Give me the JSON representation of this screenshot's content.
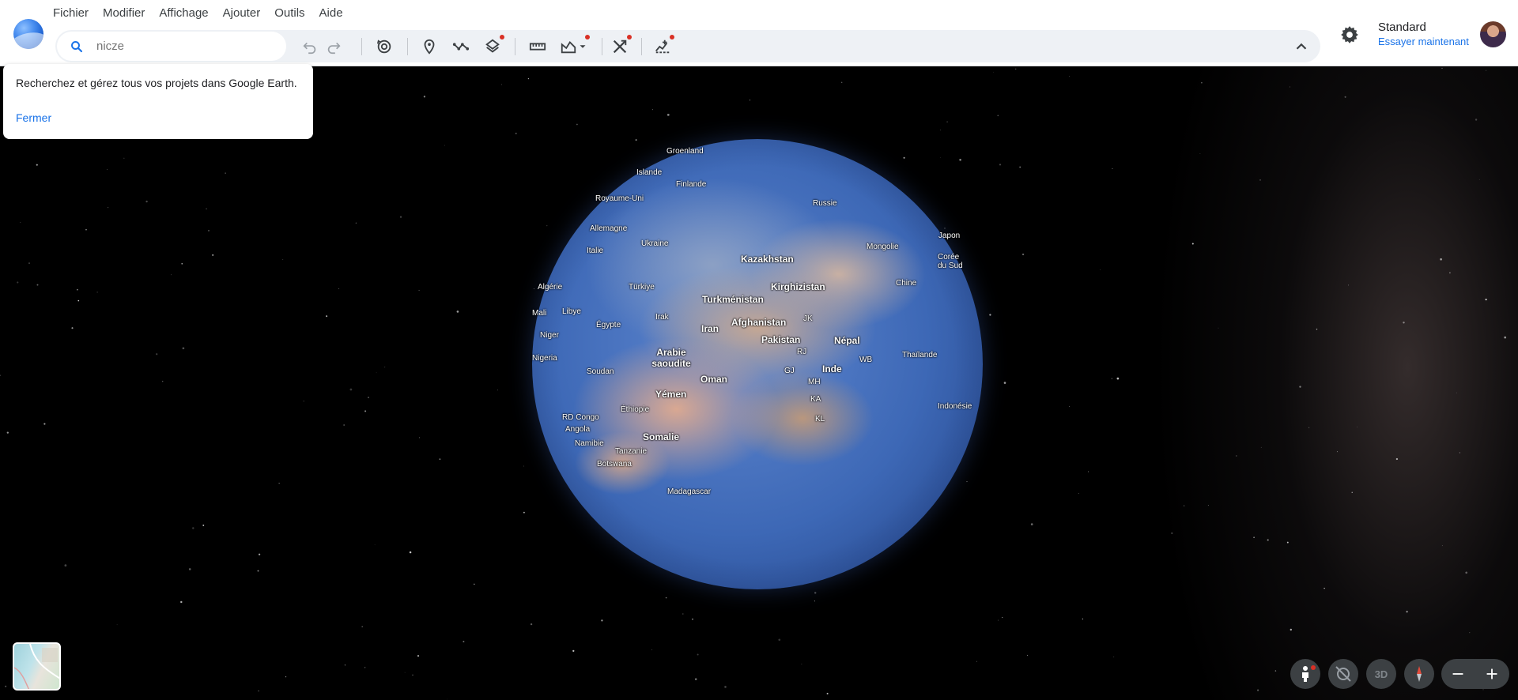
{
  "menubar": {
    "items": [
      "Fichier",
      "Modifier",
      "Affichage",
      "Ajouter",
      "Outils",
      "Aide"
    ]
  },
  "search": {
    "placeholder": "nicze"
  },
  "toolbar": {
    "undo_icon": "undo-icon",
    "redo_icon": "redo-icon",
    "history_icon": "history-icon",
    "placemark_icon": "placemark-icon",
    "path_icon": "path-icon",
    "layers_icon": "layers-icon",
    "ruler_icon": "ruler-icon",
    "image_overlay_icon": "image-overlay-icon",
    "tools_icon": "tools-icon",
    "data_import_icon": "data-import-icon",
    "collapse_icon": "chevron-up-icon"
  },
  "account": {
    "plan": "Standard",
    "upgrade_link": "Essayer maintenant"
  },
  "popup": {
    "message": "Recherchez et gérez tous vos projets dans Google Earth.",
    "close_label": "Fermer"
  },
  "globe": {
    "labels": [
      {
        "text": "Groenland",
        "big": false
      },
      {
        "text": "Islande",
        "big": false
      },
      {
        "text": "Finlande",
        "big": false
      },
      {
        "text": "Royaume-Uni",
        "big": false
      },
      {
        "text": "Russie",
        "big": false
      },
      {
        "text": "Allemagne",
        "big": false
      },
      {
        "text": "Ukraine",
        "big": false
      },
      {
        "text": "Italie",
        "big": false
      },
      {
        "text": "Kazakhstan",
        "big": true
      },
      {
        "text": "Mongolie",
        "big": false
      },
      {
        "text": "Japon",
        "big": false
      },
      {
        "text": "Corée du Sud",
        "big": false
      },
      {
        "text": "Algérie",
        "big": false
      },
      {
        "text": "Türkiye",
        "big": false
      },
      {
        "text": "Kirghizistan",
        "big": true
      },
      {
        "text": "Chine",
        "big": false
      },
      {
        "text": "Turkménistan",
        "big": true
      },
      {
        "text": "Mali",
        "big": false
      },
      {
        "text": "Libye",
        "big": false
      },
      {
        "text": "Irak",
        "big": false
      },
      {
        "text": "Afghanistan",
        "big": true
      },
      {
        "text": "JK",
        "big": false
      },
      {
        "text": "Égypte",
        "big": false
      },
      {
        "text": "Iran",
        "big": true
      },
      {
        "text": "Niger",
        "big": false
      },
      {
        "text": "Pakistan",
        "big": true
      },
      {
        "text": "Népal",
        "big": true
      },
      {
        "text": "RJ",
        "big": false
      },
      {
        "text": "Nigeria",
        "big": false
      },
      {
        "text": "Arabie saoudite",
        "big": true
      },
      {
        "text": "WB",
        "big": false
      },
      {
        "text": "Thaïlande",
        "big": false
      },
      {
        "text": "GJ",
        "big": false
      },
      {
        "text": "Inde",
        "big": true
      },
      {
        "text": "Soudan",
        "big": false
      },
      {
        "text": "Oman",
        "big": true
      },
      {
        "text": "MH",
        "big": false
      },
      {
        "text": "Yémen",
        "big": true
      },
      {
        "text": "KA",
        "big": false
      },
      {
        "text": "Éthiopie",
        "big": false
      },
      {
        "text": "Indonésie",
        "big": false
      },
      {
        "text": "KL",
        "big": false
      },
      {
        "text": "RD Congo",
        "big": false
      },
      {
        "text": "Angola",
        "big": false
      },
      {
        "text": "Somalie",
        "big": true
      },
      {
        "text": "Namibie",
        "big": false
      },
      {
        "text": "Tanzanie",
        "big": false
      },
      {
        "text": "Botswana",
        "big": false
      },
      {
        "text": "Madagascar",
        "big": false
      }
    ]
  },
  "controls": {
    "pegman_icon": "pegman-icon",
    "tilt_icon": "tilt-off-icon",
    "view_3d_label": "3D",
    "compass_icon": "compass-icon",
    "zoom_out_icon": "minus-icon",
    "zoom_in_icon": "plus-icon",
    "map_style_icon": "map-style-thumbnail"
  },
  "colors": {
    "accent": "#1a73e8",
    "notification_dot": "#d93025",
    "control_bg": "#3c4043"
  }
}
